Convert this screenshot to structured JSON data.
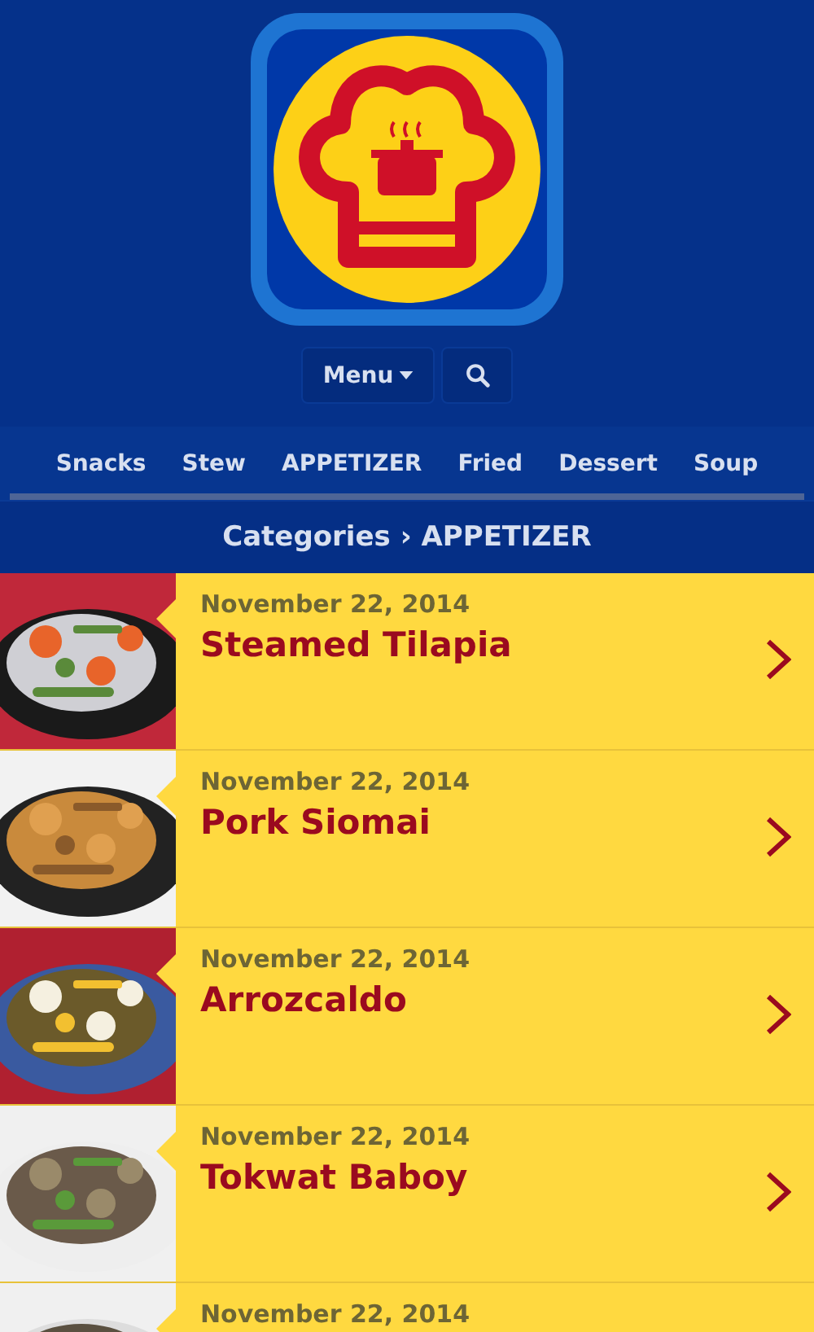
{
  "header": {
    "menu_button": "Menu"
  },
  "category_tabs": [
    {
      "label": "Snacks"
    },
    {
      "label": "Stew"
    },
    {
      "label": "APPETIZER"
    },
    {
      "label": "Fried"
    },
    {
      "label": "Dessert"
    },
    {
      "label": "Soup"
    }
  ],
  "breadcrumb": {
    "parent": "Categories",
    "separator": "›",
    "current": "APPETIZER"
  },
  "recipes": [
    {
      "date": "November 22, 2014",
      "title": "Steamed Tilapia"
    },
    {
      "date": "November 22, 2014",
      "title": "Pork Siomai"
    },
    {
      "date": "November 22, 2014",
      "title": "Arrozcaldo"
    },
    {
      "date": "November 22, 2014",
      "title": "Tokwat Baboy"
    },
    {
      "date": "November 22, 2014"
    }
  ]
}
